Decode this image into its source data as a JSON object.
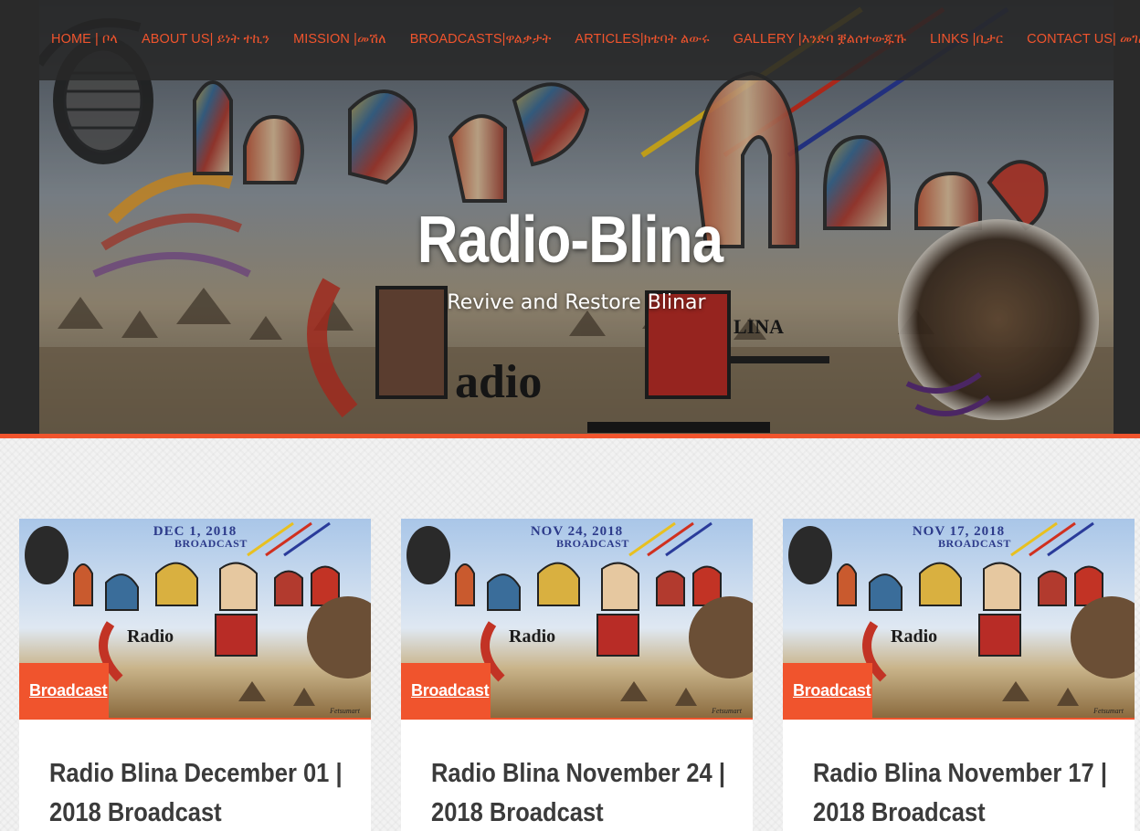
{
  "colors": {
    "accent": "#f0542d",
    "nav_bg": "#2a2a2a",
    "title": "#ffffff",
    "card_title": "#3b3b3b"
  },
  "nav": {
    "items": [
      {
        "label": "HOME | ቦላ"
      },
      {
        "label": "ABOUT US| ይነት ተኪን"
      },
      {
        "label": "MISSION |መሽለ"
      },
      {
        "label": "BROADCASTS|ዋልቃታት"
      },
      {
        "label": "ARTICLES|ክቴባት ልውሩ"
      },
      {
        "label": "GALLERY |እንድባ ቛልሰተውጁኹ"
      },
      {
        "label": "LINKS |ቢታር"
      },
      {
        "label": "CONTACT US| መገለይ"
      }
    ]
  },
  "site": {
    "title": "Radio-Blina",
    "tagline": "Revive and Restore Blinar"
  },
  "posts": [
    {
      "category": "Broadcast",
      "title": "Radio Blina December 01 | 2018 Broadcast",
      "thumb": {
        "date": "DEC 1, 2018",
        "subtitle": "BROADCAST",
        "radio": "Radio",
        "credit": "Fetsumart"
      }
    },
    {
      "category": "Broadcast",
      "title": "Radio Blina November 24 | 2018 Broadcast",
      "thumb": {
        "date": "NOV 24, 2018",
        "subtitle": "BROADCAST",
        "radio": "Radio",
        "credit": "Fetsumart"
      }
    },
    {
      "category": "Broadcast",
      "title": "Radio Blina November 17 | 2018 Broadcast",
      "thumb": {
        "date": "NOV 17, 2018",
        "subtitle": "BROADCAST",
        "radio": "Radio",
        "credit": "Fetsumart"
      }
    }
  ]
}
